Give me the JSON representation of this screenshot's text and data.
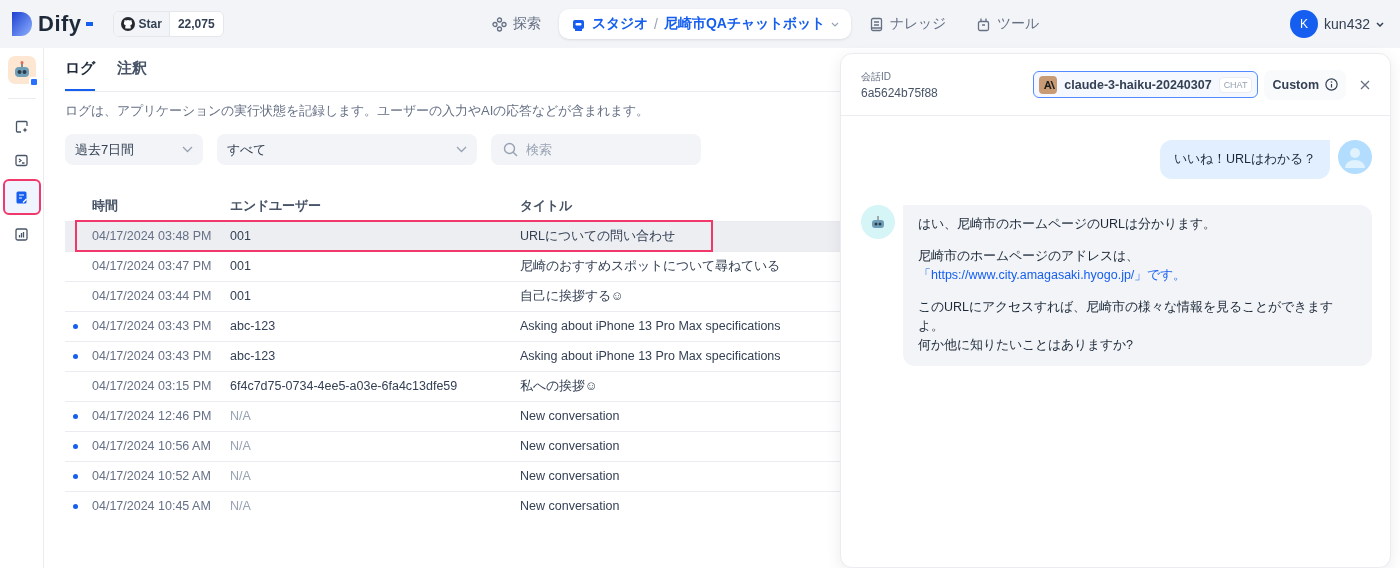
{
  "brand": {
    "name": "Dify",
    "star_label": "Star",
    "star_count": "22,075"
  },
  "nav": [
    {
      "kind": "explore",
      "label": "探索",
      "selected": false
    },
    {
      "kind": "studio",
      "label": "スタジオ",
      "separator": "/",
      "app": "尼崎市QAチャットボット",
      "selected": true
    },
    {
      "kind": "knowledge",
      "label": "ナレッジ",
      "selected": false
    },
    {
      "kind": "tools",
      "label": "ツール",
      "selected": false
    }
  ],
  "user": {
    "initial": "K",
    "name": "kun432"
  },
  "sidebar": {
    "items": [
      {
        "kind": "orchestrate",
        "selected": false,
        "annotated": false
      },
      {
        "kind": "api",
        "selected": false,
        "annotated": false
      },
      {
        "kind": "logs",
        "selected": true,
        "annotated": true
      },
      {
        "kind": "overview",
        "selected": false,
        "annotated": false
      }
    ]
  },
  "tabs": [
    {
      "label": "ログ",
      "selected": true
    },
    {
      "label": "注釈",
      "selected": false
    }
  ],
  "description": "ログは、アプリケーションの実行状態を記録します。ユーザーの入力やAIの応答などが含まれます。",
  "filters": {
    "period": "過去7日間",
    "status": "すべて",
    "search_placeholder": "検索"
  },
  "table": {
    "columns": [
      "時間",
      "エンドユーザー",
      "タイトル"
    ],
    "rows": [
      {
        "time": "04/17/2024 03:48 PM",
        "user": "001",
        "title": "URLについての問い合わせ",
        "unread": false,
        "selected": true,
        "annotated": true,
        "user_muted": false
      },
      {
        "time": "04/17/2024 03:47 PM",
        "user": "001",
        "title": "尼崎のおすすめスポットについて尋ねている",
        "unread": false,
        "selected": false,
        "annotated": false,
        "user_muted": false
      },
      {
        "time": "04/17/2024 03:44 PM",
        "user": "001",
        "title": "自己に挨拶する☺",
        "unread": false,
        "selected": false,
        "annotated": false,
        "user_muted": false
      },
      {
        "time": "04/17/2024 03:43 PM",
        "user": "abc-123",
        "title": "Asking about iPhone 13 Pro Max specifications",
        "unread": true,
        "selected": false,
        "annotated": false,
        "user_muted": false
      },
      {
        "time": "04/17/2024 03:43 PM",
        "user": "abc-123",
        "title": "Asking about iPhone 13 Pro Max specifications",
        "unread": true,
        "selected": false,
        "annotated": false,
        "user_muted": false
      },
      {
        "time": "04/17/2024 03:15 PM",
        "user": "6f4c7d75-0734-4ee5-a03e-6fa4c13dfe59",
        "title": "私への挨拶☺",
        "unread": false,
        "selected": false,
        "annotated": false,
        "user_muted": false
      },
      {
        "time": "04/17/2024 12:46 PM",
        "user": "N/A",
        "title": "New conversation",
        "unread": true,
        "selected": false,
        "annotated": false,
        "user_muted": true
      },
      {
        "time": "04/17/2024 10:56 AM",
        "user": "N/A",
        "title": "New conversation",
        "unread": true,
        "selected": false,
        "annotated": false,
        "user_muted": true
      },
      {
        "time": "04/17/2024 10:52 AM",
        "user": "N/A",
        "title": "New conversation",
        "unread": true,
        "selected": false,
        "annotated": false,
        "user_muted": true
      },
      {
        "time": "04/17/2024 10:45 AM",
        "user": "N/A",
        "title": "New conversation",
        "unread": true,
        "selected": false,
        "annotated": false,
        "user_muted": true
      }
    ]
  },
  "panel": {
    "id_label": "会話ID",
    "id": "6a5624b75f88",
    "model": "claude-3-haiku-20240307",
    "model_mode": "CHAT",
    "custom": "Custom",
    "messages": [
      {
        "kind": "user",
        "paragraphs": [
          [
            [
              {
                "kind": "text",
                "text": "いいね！URLはわかる？"
              }
            ]
          ]
        ]
      },
      {
        "kind": "assistant",
        "paragraphs": [
          [
            [
              {
                "kind": "text",
                "text": "はい、尼崎市のホームページのURLは分かります。"
              }
            ]
          ],
          [
            [
              {
                "kind": "text",
                "text": "尼崎市のホームページのアドレスは、"
              },
              {
                "kind": "link",
                "text": "「https://www.city.amagasaki.hyogo.jp/」です。"
              }
            ]
          ],
          [
            [
              {
                "kind": "text",
                "text": "このURLにアクセスすれば、尼崎市の様々な情報を見ることができますよ。"
              }
            ],
            [
              {
                "kind": "text",
                "text": "何か他に知りたいことはありますか?"
              }
            ]
          ]
        ]
      }
    ]
  }
}
